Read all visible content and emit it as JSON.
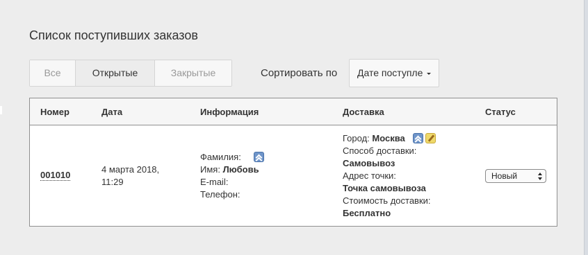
{
  "page_title": "Список поступивших заказов",
  "filters": [
    {
      "label": "Все",
      "active": false
    },
    {
      "label": "Открытые",
      "active": true
    },
    {
      "label": "Закрытые",
      "active": false
    }
  ],
  "sort": {
    "label": "Сортировать по",
    "selected": "Дате поступле"
  },
  "table": {
    "headers": [
      "Номер",
      "Дата",
      "Информация",
      "Доставка",
      "Статус"
    ],
    "row": {
      "number": "001010",
      "date_line1": "4 марта 2018,",
      "date_line2": "11:29",
      "info": {
        "surname_label": "Фамилия:",
        "name_label": "Имя:",
        "name_value": "Любовь",
        "email_label": "E-mail:",
        "phone_label": "Телефон:"
      },
      "delivery": {
        "city_label": "Город:",
        "city_value": "Москва",
        "method_label": "Способ доставки:",
        "method_value": "Самовывоз",
        "address_label": "Адрес точки:",
        "address_value": "Точка самовывоза",
        "cost_label": "Стоимость доставки:",
        "cost_value": "Бесплатно"
      },
      "status": "Новый"
    }
  },
  "icons": {
    "expand": "double-chevron-up-icon",
    "edit": "pencil-icon"
  },
  "colors": {
    "icon_blue": "#6f95c9",
    "icon_yellow": "#efd96a",
    "table_border": "#8f8f8f"
  }
}
